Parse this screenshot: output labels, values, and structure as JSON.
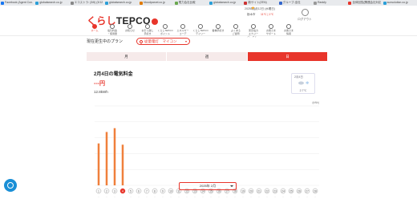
{
  "browser_tabs": [
    {
      "label": "Facebook (Agent Con...",
      "color": "#1877f2"
    },
    {
      "label": "globalsearch.co.jp",
      "color": "#2a9fd8"
    },
    {
      "label": "エコストラ: (3/6) (3/12)",
      "color": "#888888"
    },
    {
      "label": "globalsearch.co.jp",
      "color": "#2a9fd8"
    },
    {
      "label": "bloodparcel.co.jp",
      "color": "#e07b00"
    },
    {
      "label": "電力会社比較",
      "color": "#6aa84f"
    },
    {
      "label": "globalsearch.co.jp",
      "color": "#2a9fd8"
    },
    {
      "label": "新サイト(ZEN)",
      "color": "#cc3333"
    },
    {
      "label": "グループ-全社",
      "color": "#3366cc"
    },
    {
      "label": "Rankfy",
      "color": "#999999"
    },
    {
      "label": "全体回覧(関連会社対応",
      "color": "#e8352b"
    },
    {
      "label": "sunsolution.co.jp",
      "color": "#2a9fd8"
    }
  ],
  "header": {
    "logo_mark": "くらし",
    "logo_text": "TEPCO",
    "logo_badge": "web",
    "datetime": "2025年2月12日 (水曜日)",
    "location": "栃木市",
    "temp_range": "11℃ | 1℃",
    "login_label": "ログアウト"
  },
  "nav": [
    {
      "label": "ホーム",
      "active": true
    },
    {
      "label": "電気料金\n・使用量",
      "active": false
    },
    {
      "label": "お知らせ",
      "active": false
    },
    {
      "label": "お引っ越し\n手続き",
      "active": false
    },
    {
      "label": "くらしTEPCO\nポイント",
      "active": false
    },
    {
      "label": "エネルギー\nコーデ",
      "active": false
    },
    {
      "label": "くらしTEPCO\nデイリー",
      "active": false
    },
    {
      "label": "各種手続き",
      "active": false
    },
    {
      "label": "よくある\nご質問",
      "active": false
    },
    {
      "label": "東京電力\nエナジー\nパートナー",
      "active": false
    },
    {
      "label": "お客さま\nサポート",
      "active": false
    },
    {
      "label": "お客さま\n情報",
      "active": false
    }
  ],
  "plan": {
    "label": "現在更生中のプラン",
    "value": "従量電灯　マイコン"
  },
  "period_tabs": [
    {
      "label": "月",
      "active": false
    },
    {
      "label": "週",
      "active": false
    },
    {
      "label": "日",
      "active": true
    }
  ],
  "card": {
    "title": "2月4日の電気料金",
    "amount": "---円",
    "usage": "12.8kWh"
  },
  "weather_box": {
    "date": "2月4日",
    "temp": "2.7℃"
  },
  "chart_data": {
    "type": "bar",
    "ylabel": "(kWh)",
    "categories": [
      "1",
      "2",
      "3",
      "4",
      "5",
      "6",
      "7",
      "8",
      "9",
      "10",
      "11",
      "12",
      "13",
      "14",
      "15",
      "16",
      "17",
      "18",
      "19",
      "20",
      "21",
      "22",
      "23",
      "24",
      "25",
      "26",
      "27",
      "28"
    ],
    "values": [
      13.2,
      16.8,
      18.0,
      12.8,
      null,
      null,
      null,
      null,
      null,
      null,
      null,
      null,
      null,
      null,
      null,
      null,
      null,
      null,
      null,
      null,
      null,
      null,
      null,
      null,
      null,
      null,
      null,
      null
    ],
    "selected_index": 3,
    "ylim": [
      0,
      25
    ],
    "bar_color": "#f0803c",
    "selected_color": "#e8352b"
  },
  "month_select": {
    "value": "2025年 2月"
  }
}
